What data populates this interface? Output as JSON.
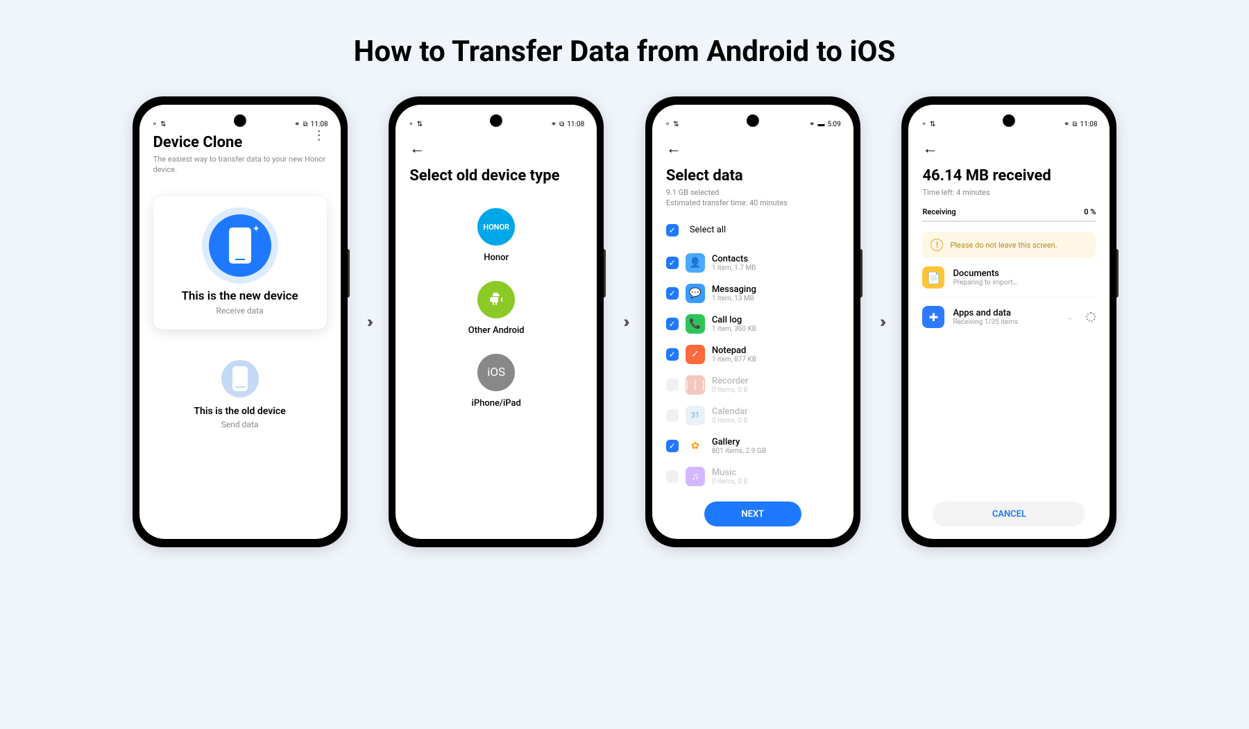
{
  "title": "How to Transfer Data from Android to iOS",
  "arrows": "›››",
  "status": {
    "wifi": "⚬ ⇅",
    "bt": "⚭",
    "time1": "11:08",
    "time2": "11:08",
    "time3": "5:09",
    "time4": "11:08"
  },
  "phone1": {
    "title": "Device Clone",
    "subtitle": "The easiest way to transfer data to your new Honor device.",
    "newDevice": "This is the new device",
    "newSub": "Receive data",
    "oldDevice": "This is the old device",
    "oldSub": "Send data"
  },
  "phone2": {
    "title": "Select old device type",
    "honor": "HONOR",
    "honorLabel": "Honor",
    "androidLabel": "Other Android",
    "iosText": "iOS",
    "iosLabel": "iPhone/iPad"
  },
  "phone3": {
    "title": "Select data",
    "sub1": "9.1 GB selected",
    "sub2": "Estimated transfer time: 40 minutes",
    "selectAll": "Select all",
    "items": [
      {
        "name": "Contacts",
        "sub": "1 item, 1.7 MB",
        "checked": true,
        "dim": false,
        "color": "#4aa8ff",
        "icon": "👤"
      },
      {
        "name": "Messaging",
        "sub": "1 item, 13 MB",
        "checked": true,
        "dim": false,
        "color": "#3b9bff",
        "icon": "💬"
      },
      {
        "name": "Call log",
        "sub": "1 item, 360 KB",
        "checked": true,
        "dim": false,
        "color": "#2ec458",
        "icon": "📞"
      },
      {
        "name": "Notepad",
        "sub": "1 item, 877 KB",
        "checked": true,
        "dim": false,
        "color": "#ff6a3d",
        "icon": "✓"
      },
      {
        "name": "Recorder",
        "sub": "0 items, 0 B",
        "checked": false,
        "dim": true,
        "color": "#f5c6c0",
        "icon": "❘❘❘"
      },
      {
        "name": "Calendar",
        "sub": "0 items, 0 B",
        "checked": false,
        "dim": true,
        "color": "#e8f0f8",
        "icon": "31"
      },
      {
        "name": "Gallery",
        "sub": "801 items, 2.9 GB",
        "checked": true,
        "dim": false,
        "color": "#fff",
        "icon": "✿"
      },
      {
        "name": "Music",
        "sub": "0 items, 0 B",
        "checked": false,
        "dim": true,
        "color": "#d4b8ff",
        "icon": "♫"
      }
    ],
    "next": "NEXT"
  },
  "phone4": {
    "title": "46.14 MB received",
    "subtitle": "Time left: 4 minutes",
    "receiving": "Receiving",
    "percent": "0 %",
    "alert": "Please do not leave this screen.",
    "docs": "Documents",
    "docsSub": "Preparing to import…",
    "apps": "Apps and data",
    "appsSub": "Receiving 1/35 items",
    "cancel": "CANCEL"
  }
}
